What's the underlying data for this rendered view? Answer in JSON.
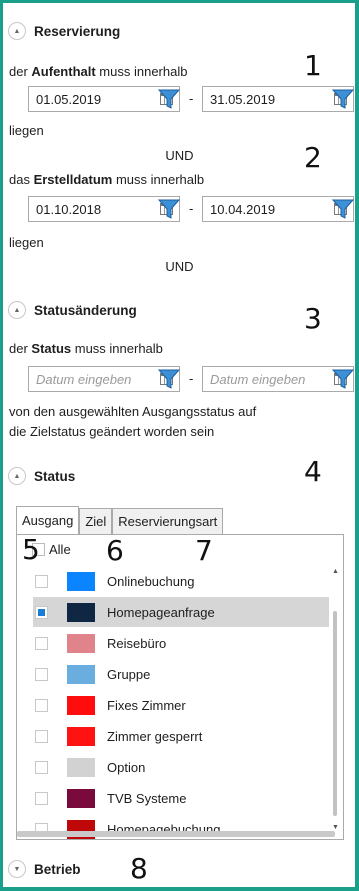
{
  "sections": {
    "reservierung": {
      "title": "Reservierung",
      "toggle": "chevron-up-icon",
      "aufenthalt": {
        "pre": "der ",
        "bold": "Aufenthalt",
        "post": " muss innerhalb",
        "from": "01.05.2019",
        "to": "31.05.2019",
        "suffix": "liegen"
      },
      "und1": "UND",
      "erstelldatum": {
        "pre": "das ",
        "bold": "Erstelldatum",
        "post": " muss innerhalb",
        "from": "01.10.2018",
        "to": "10.04.2019",
        "suffix": "liegen"
      },
      "und2": "UND"
    },
    "statusaenderung": {
      "title": "Statusänderung",
      "toggle": "chevron-up-icon",
      "status_text": {
        "pre": "der ",
        "bold": "Status",
        "post": " muss innerhalb"
      },
      "from_placeholder": "Datum eingeben",
      "to_placeholder": "Datum eingeben",
      "desc_line1": "von den ausgewählten Ausgangsstatus auf",
      "desc_line2": "die Zielstatus geändert worden sein"
    },
    "status": {
      "title": "Status",
      "toggle": "chevron-up-icon",
      "tabs": [
        "Ausgang",
        "Ziel",
        "Reservierungsart"
      ],
      "active_tab": "Ausgang",
      "select_all": "Alle",
      "items": [
        {
          "label": "Onlinebuchung",
          "color": "#0a84ff",
          "checked": false
        },
        {
          "label": "Homepageanfrage",
          "color": "#0f2742",
          "checked": true
        },
        {
          "label": "Reisebüro",
          "color": "#e0838a",
          "checked": false
        },
        {
          "label": "Gruppe",
          "color": "#6aaee0",
          "checked": false
        },
        {
          "label": "Fixes Zimmer",
          "color": "#ff0d0d",
          "checked": false
        },
        {
          "label": "Zimmer gesperrt",
          "color": "#ff1212",
          "checked": false
        },
        {
          "label": "Option",
          "color": "#d2d2d2",
          "checked": false
        },
        {
          "label": "TVB Systeme",
          "color": "#7a0a3c",
          "checked": false
        },
        {
          "label": "Homepagebuchung",
          "color": "#c00808",
          "checked": false
        }
      ]
    },
    "betrieb": {
      "title": "Betrieb",
      "toggle": "chevron-down-icon"
    }
  },
  "annotations": [
    "1",
    "2",
    "3",
    "4",
    "5",
    "6",
    "7",
    "8"
  ],
  "colors": {
    "frame": "#1aa08a",
    "funnel": "#3d8fd6",
    "checkbox_checked": "#1a7fd4"
  },
  "icons": {
    "date_picker": "calendar-icon",
    "filter": "funnel-icon"
  }
}
